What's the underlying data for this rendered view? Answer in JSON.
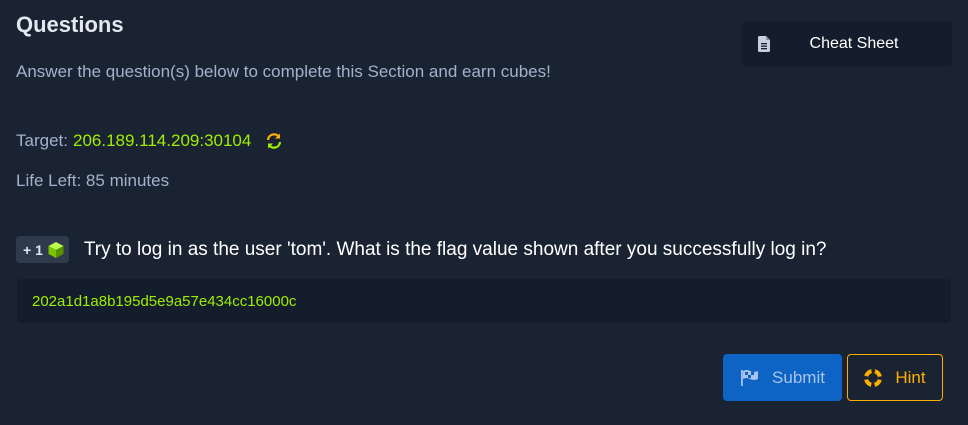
{
  "section": {
    "title": "Questions",
    "subtitle": "Answer the question(s) below to complete this Section and earn cubes!"
  },
  "cheat_sheet": {
    "label": "Cheat Sheet",
    "icon": "document-icon"
  },
  "target": {
    "label": "Target:",
    "value": "206.189.114.209:30104",
    "icon": "refresh-icon"
  },
  "life": {
    "text": "Life Left: 85 minutes"
  },
  "question": {
    "cubes": "+ 1",
    "cube_icon": "cube-icon",
    "text": "Try to log in as the user 'tom'. What is the flag value shown after you successfully log in?",
    "answer": "202a1d1a8b195d5e9a57e434cc16000c"
  },
  "actions": {
    "submit_label": "Submit",
    "submit_icon": "flag-icon",
    "hint_label": "Hint",
    "hint_icon": "life-ring-icon"
  },
  "colors": {
    "background": "#1a2332",
    "panel": "#141d2b",
    "accent_green": "#9fef00",
    "submit_blue": "#0d64c5",
    "hint_orange": "#ffaf00"
  }
}
